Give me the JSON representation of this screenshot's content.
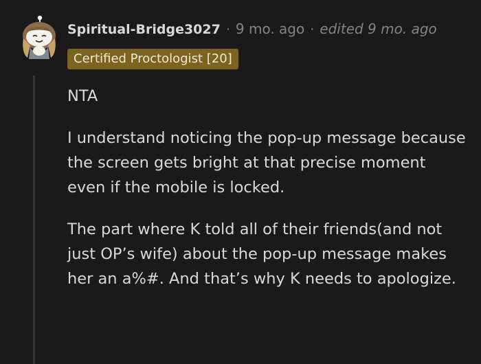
{
  "comment": {
    "author": "Spiritual-Bridge3027",
    "separator": "·",
    "age": "9 mo. ago",
    "edited": "edited 9 mo. ago",
    "flair": "Certified Proctologist [20]",
    "flair_color": "#7a6420",
    "avatar_icon": "snoo-avatar-icon",
    "paragraphs": [
      "NTA",
      "I understand noticing the pop-up message because the screen gets bright at that precise moment even if the mobile is locked.",
      "The part where K told all of their friends(and not just OP’s wife) about the pop-up message makes her an a%#. And that’s why K needs to apologize."
    ]
  },
  "colors": {
    "background": "#1a1a1b",
    "text": "#d7dadc",
    "meta": "#818384",
    "thread_line": "#343536"
  }
}
